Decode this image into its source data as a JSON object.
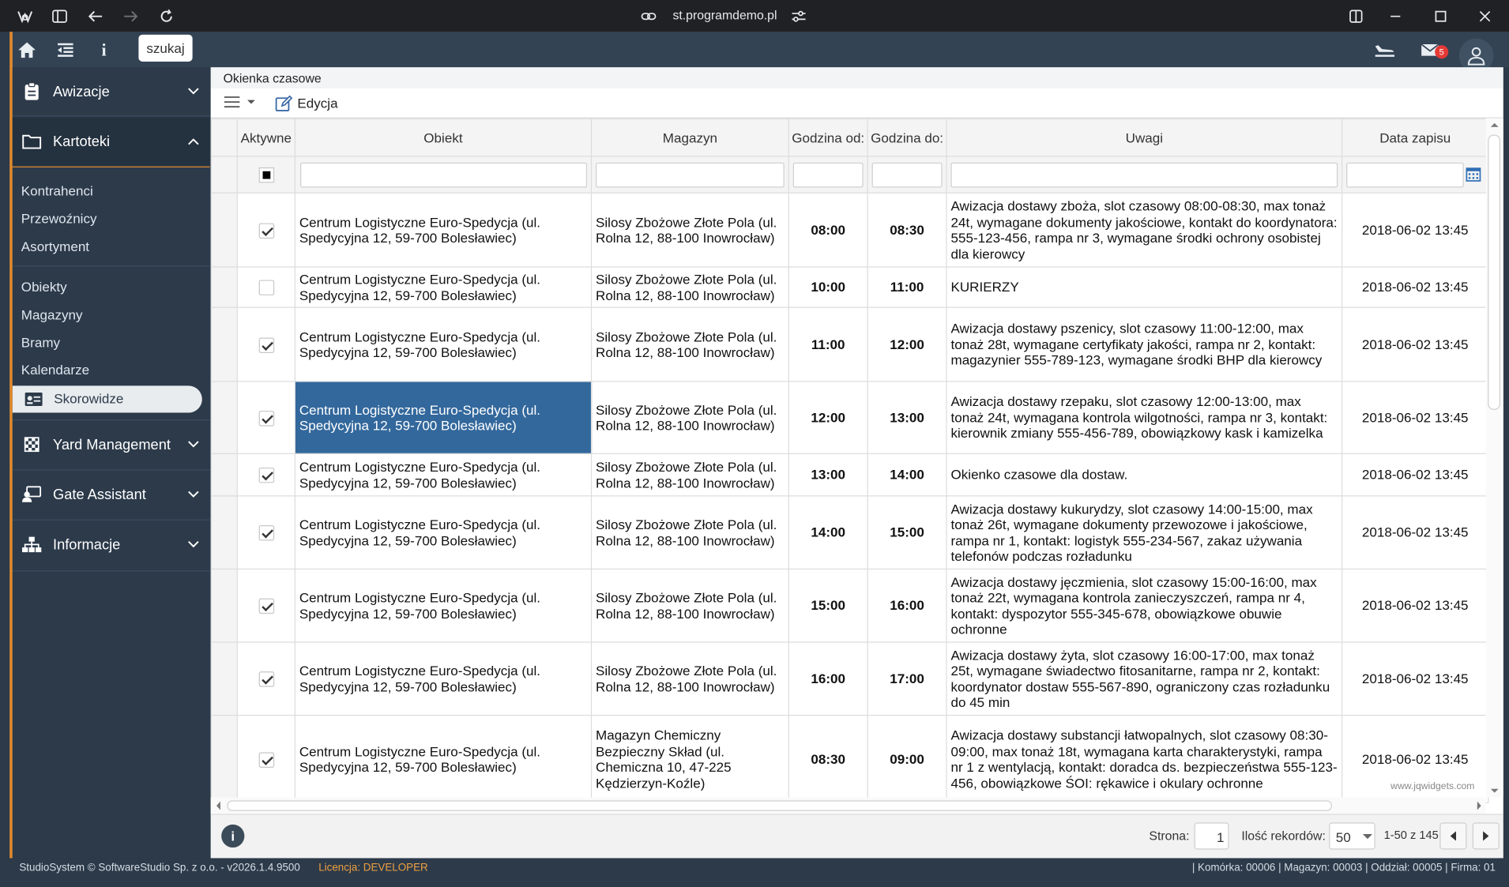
{
  "browser": {
    "url": "st.programdemo.pl"
  },
  "header": {
    "search_label": "szukaj",
    "mail_count": "5"
  },
  "sidebar": {
    "sections": [
      {
        "label": "Awizacje",
        "icon": "clipboard-icon",
        "expanded": false
      },
      {
        "label": "Kartoteki",
        "icon": "folder-icon",
        "expanded": true
      },
      {
        "label": "Yard Management",
        "icon": "checkered-flag-icon",
        "expanded": false
      },
      {
        "label": "Gate Assistant",
        "icon": "gate-assistant-icon",
        "expanded": false
      },
      {
        "label": "Informacje",
        "icon": "sitemap-icon",
        "expanded": false
      }
    ],
    "items": [
      "Kontrahenci",
      "Przewoźnicy",
      "Asortyment",
      "Obiekty",
      "Magazyny",
      "Bramy",
      "Kalendarze"
    ],
    "selected_item": "Skorowidze"
  },
  "breadcrumb": "Okienka czasowe",
  "toolbar": {
    "edit_label": "Edycja"
  },
  "grid": {
    "columns": [
      "Aktywne",
      "Obiekt",
      "Magazyn",
      "Godzina od:",
      "Godzina do:",
      "Uwagi",
      "Data zapisu"
    ],
    "rows": [
      {
        "active": true,
        "obiekt": "Centrum Logistyczne Euro-Spedycja (ul. Spedycyjna 12, 59-700 Bolesławiec)",
        "magazyn": "Silosy Zbożowe Złote Pola (ul. Rolna 12, 88-100 Inowrocław)",
        "od": "08:00",
        "do": "08:30",
        "uwagi": "Awizacja dostawy zboża, slot czasowy 08:00-08:30, max tonaż 24t, wymagane dokumenty jakościowe, kontakt do koordynatora: 555-123-456, rampa nr 3, wymagane środki ochrony osobistej dla kierowcy",
        "data": "2018-06-02 13:45"
      },
      {
        "active": false,
        "obiekt": "Centrum Logistyczne Euro-Spedycja (ul. Spedycyjna 12, 59-700 Bolesławiec)",
        "magazyn": "Silosy Zbożowe Złote Pola (ul. Rolna 12, 88-100 Inowrocław)",
        "od": "10:00",
        "do": "11:00",
        "uwagi": "KURIERZY",
        "data": "2018-06-02 13:45"
      },
      {
        "active": true,
        "obiekt": "Centrum Logistyczne Euro-Spedycja (ul. Spedycyjna 12, 59-700 Bolesławiec)",
        "magazyn": "Silosy Zbożowe Złote Pola (ul. Rolna 12, 88-100 Inowrocław)",
        "od": "11:00",
        "do": "12:00",
        "uwagi": "Awizacja dostawy pszenicy, slot czasowy 11:00-12:00, max tonaż 28t, wymagane certyfikaty jakości, rampa nr 2, kontakt: magazynier 555-789-123, wymagane środki BHP dla kierowcy",
        "data": "2018-06-02 13:45"
      },
      {
        "active": true,
        "obiekt": "Centrum Logistyczne Euro-Spedycja (ul. Spedycyjna 12, 59-700 Bolesławiec)",
        "magazyn": "Silosy Zbożowe Złote Pola (ul. Rolna 12, 88-100 Inowrocław)",
        "od": "12:00",
        "do": "13:00",
        "uwagi": "Awizacja dostawy rzepaku, slot czasowy 12:00-13:00, max tonaż 24t, wymagana kontrola wilgotności, rampa nr 3, kontakt: kierownik zmiany 555-456-789, obowiązkowy kask i kamizelka",
        "data": "2018-06-02 13:45",
        "selected": true
      },
      {
        "active": true,
        "obiekt": "Centrum Logistyczne Euro-Spedycja (ul. Spedycyjna 12, 59-700 Bolesławiec)",
        "magazyn": "Silosy Zbożowe Złote Pola (ul. Rolna 12, 88-100 Inowrocław)",
        "od": "13:00",
        "do": "14:00",
        "uwagi": "Okienko czasowe dla dostaw.",
        "data": "2018-06-02 13:45"
      },
      {
        "active": true,
        "obiekt": "Centrum Logistyczne Euro-Spedycja (ul. Spedycyjna 12, 59-700 Bolesławiec)",
        "magazyn": "Silosy Zbożowe Złote Pola (ul. Rolna 12, 88-100 Inowrocław)",
        "od": "14:00",
        "do": "15:00",
        "uwagi": "Awizacja dostawy kukurydzy, slot czasowy 14:00-15:00, max tonaż 26t, wymagane dokumenty przewozowe i jakościowe, rampa nr 1, kontakt: logistyk 555-234-567, zakaz używania telefonów podczas rozładunku",
        "data": "2018-06-02 13:45"
      },
      {
        "active": true,
        "obiekt": "Centrum Logistyczne Euro-Spedycja (ul. Spedycyjna 12, 59-700 Bolesławiec)",
        "magazyn": "Silosy Zbożowe Złote Pola (ul. Rolna 12, 88-100 Inowrocław)",
        "od": "15:00",
        "do": "16:00",
        "uwagi": "Awizacja dostawy jęczmienia, slot czasowy 15:00-16:00, max tonaż 22t, wymagana kontrola zanieczyszczeń, rampa nr 4, kontakt: dyspozytor 555-345-678, obowiązkowe obuwie ochronne",
        "data": "2018-06-02 13:45"
      },
      {
        "active": true,
        "obiekt": "Centrum Logistyczne Euro-Spedycja (ul. Spedycyjna 12, 59-700 Bolesławiec)",
        "magazyn": "Silosy Zbożowe Złote Pola (ul. Rolna 12, 88-100 Inowrocław)",
        "od": "16:00",
        "do": "17:00",
        "uwagi": "Awizacja dostawy żyta, slot czasowy 16:00-17:00, max tonaż 25t, wymagane świadectwo fitosanitarne, rampa nr 2, kontakt: koordynator dostaw 555-567-890, ograniczony czas rozładunku do 45 min",
        "data": "2018-06-02 13:45"
      },
      {
        "active": true,
        "obiekt": "Centrum Logistyczne Euro-Spedycja (ul. Spedycyjna 12, 59-700 Bolesławiec)",
        "magazyn": "Magazyn Chemiczny Bezpieczny Skład (ul. Chemiczna 10, 47-225 Kędzierzyn-Koźle)",
        "od": "08:30",
        "do": "09:00",
        "uwagi": "Awizacja dostawy substancji łatwopalnych, slot czasowy 08:30-09:00, max tonaż 18t, wymagana karta charakterystyki, rampa nr 1 z wentylacją, kontakt: doradca ds. bezpieczeństwa 555-123-456, obowiązkowe ŚOI: rękawice i okulary ochronne",
        "data": "2018-06-02 13:45"
      }
    ]
  },
  "watermark": "www.jqwidgets.com",
  "pager": {
    "page_label": "Strona:",
    "page_value": "1",
    "records_label": "Ilość rekordów:",
    "records_value": "50",
    "range": "1-50 z 145"
  },
  "footer": {
    "left": "StudioSystem © SoftwareStudio Sp. z o.o. - v2026.1.4.9500",
    "license": "Licencja: DEVELOPER",
    "right": "| Komórka: 00006 | Magazyn: 00003 | Oddział: 00005 | Firma: 01"
  }
}
